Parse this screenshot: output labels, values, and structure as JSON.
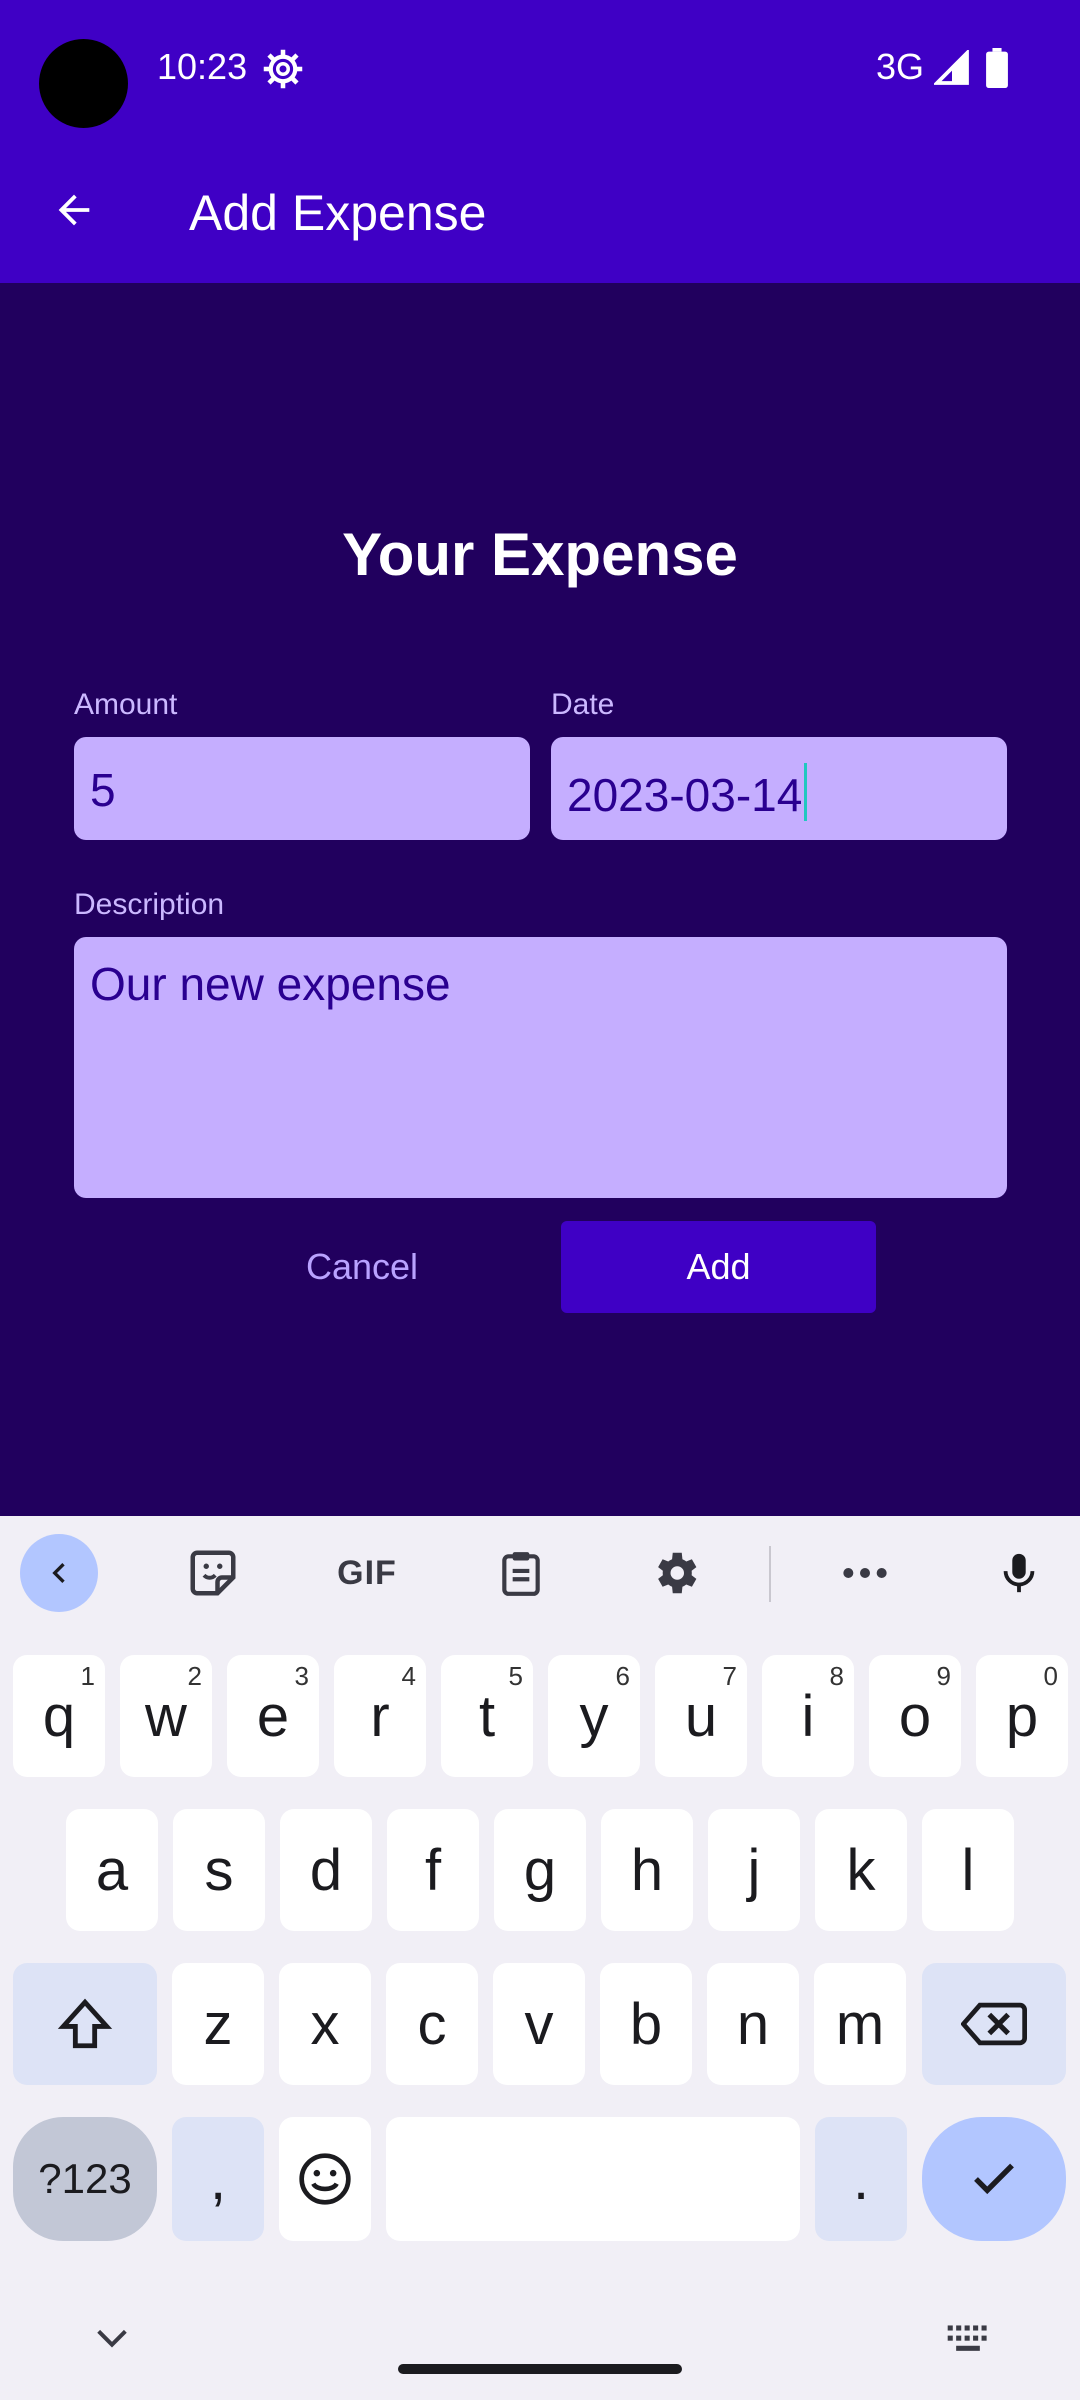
{
  "status_bar": {
    "time": "10:23",
    "network": "3G"
  },
  "app_bar": {
    "title": "Add Expense"
  },
  "form": {
    "title": "Your Expense",
    "amount": {
      "label": "Amount",
      "value": "5"
    },
    "date": {
      "label": "Date",
      "value": "2023-03-14"
    },
    "description": {
      "label": "Description",
      "value": "Our new expense"
    },
    "cancel_label": "Cancel",
    "add_label": "Add"
  },
  "keyboard": {
    "toolbar": [
      "chevron-left-icon",
      "sticker-icon",
      "GIF",
      "clipboard-icon",
      "gear-icon",
      "more-icon",
      "mic-icon"
    ],
    "gif_label": "GIF",
    "row1": [
      {
        "k": "q",
        "h": "1"
      },
      {
        "k": "w",
        "h": "2"
      },
      {
        "k": "e",
        "h": "3"
      },
      {
        "k": "r",
        "h": "4"
      },
      {
        "k": "t",
        "h": "5"
      },
      {
        "k": "y",
        "h": "6"
      },
      {
        "k": "u",
        "h": "7"
      },
      {
        "k": "i",
        "h": "8"
      },
      {
        "k": "o",
        "h": "9"
      },
      {
        "k": "p",
        "h": "0"
      }
    ],
    "row2": [
      "a",
      "s",
      "d",
      "f",
      "g",
      "h",
      "j",
      "k",
      "l"
    ],
    "row3": [
      "z",
      "x",
      "c",
      "v",
      "b",
      "n",
      "m"
    ],
    "sym_label": "?123",
    "comma": ",",
    "period": "."
  },
  "colors": {
    "app_bar": "#3f00c5",
    "background": "#21005e",
    "field": "#c5aeff",
    "accent_button": "#3f00c5"
  }
}
